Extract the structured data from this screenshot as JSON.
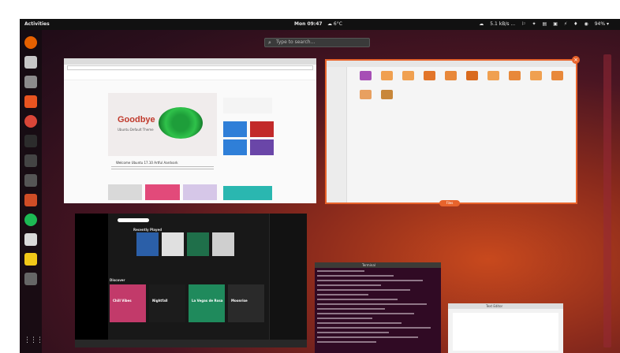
{
  "topbar": {
    "activities": "Activities",
    "clock": "Mon 09:47",
    "weather": "☁ 6°C",
    "tray": [
      "☁",
      "5.1 kB/s ...",
      "⚐",
      "✦",
      "▤",
      "▣",
      "⚡",
      "♦",
      "◉",
      "94% ▾"
    ]
  },
  "search": {
    "placeholder": "Type to search..."
  },
  "colors": {
    "accent": "#e8642c",
    "spotify_green": "#1db954"
  },
  "dock": {
    "apps": [
      {
        "name": "firefox-icon",
        "color": "#e66000"
      },
      {
        "name": "thunderbird-icon",
        "color": "#c7c7c7"
      },
      {
        "name": "files-icon",
        "color": "#8c8c8c"
      },
      {
        "name": "software-center-icon",
        "color": "#e95420"
      },
      {
        "name": "chrome-icon",
        "color": "#d94638"
      },
      {
        "name": "terminal-icon",
        "color": "#2c2c2c"
      },
      {
        "name": "screenshot-icon",
        "color": "#444"
      },
      {
        "name": "calculator-icon",
        "color": "#555"
      },
      {
        "name": "settings-icon",
        "color": "#cf4d26"
      },
      {
        "name": "spotify-icon",
        "color": "#1db954"
      },
      {
        "name": "text-editor-icon",
        "color": "#d9d9d9"
      },
      {
        "name": "notes-icon",
        "color": "#f2c818"
      },
      {
        "name": "tools-icon",
        "color": "#666"
      }
    ],
    "show_apps": "⋮⋮⋮"
  },
  "browser": {
    "headline": "Goodbye",
    "subheadline": "Ubuntu Default Theme",
    "article_title": "Welcome Ubuntu 17.10 Artful Aardvark",
    "tiles": [
      {
        "color": "#2f7fd8"
      },
      {
        "color": "#c22a2a"
      },
      {
        "color": "#2f7fd8"
      },
      {
        "color": "#6a46a8"
      }
    ]
  },
  "files": {
    "label": "Files",
    "folders": [
      "#a64fb5",
      "#f0a050",
      "#f0a050",
      "#e2752a",
      "#e8883a",
      "#d96a1e",
      "#f0a050",
      "#e8883a",
      "#f0a050",
      "#e8883a",
      "#e8a060",
      "#c8873a"
    ]
  },
  "spotify": {
    "section_top": "Recently Played",
    "section_bottom": "Discover",
    "albums_top": [
      "#2b5fa8",
      "#e0e0e0",
      "#1f6f4a",
      "#cfcfcf"
    ],
    "albums_bottom": [
      {
        "color": "#c23a6a",
        "title": "Chill Vibes"
      },
      {
        "color": "#1c1c1c",
        "title": "Nightfall"
      },
      {
        "color": "#1f8a5c",
        "title": "La Vegas de Rosa"
      },
      {
        "color": "#2a2a2a",
        "title": "Moonrise"
      }
    ]
  },
  "terminal": {
    "title": "Terminal",
    "lines": 16
  },
  "gedit": {
    "title": "Text Editor"
  }
}
